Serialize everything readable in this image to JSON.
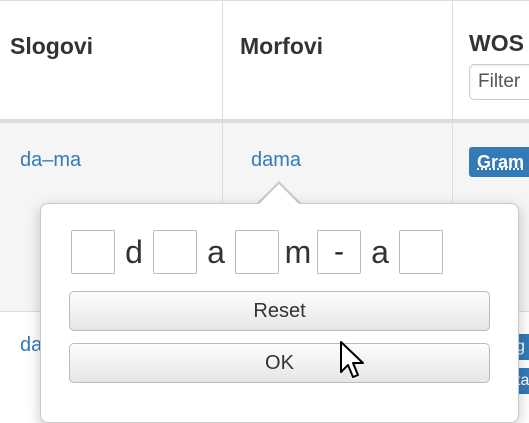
{
  "table": {
    "headers": {
      "slogovi": "Slogovi",
      "morfovi": "Morfovi",
      "wos": "WOS"
    },
    "filter_placeholder": "Filter",
    "row1": {
      "slogovi": "da–ma",
      "morfovi": "dama",
      "badge": "Gram"
    },
    "row2": {
      "slogovi": "da",
      "badge_top": "g",
      "badge_bottom": "ta"
    }
  },
  "popover": {
    "segments": [
      {
        "kind": "box",
        "value": ""
      },
      {
        "kind": "letter",
        "value": "d"
      },
      {
        "kind": "box",
        "value": ""
      },
      {
        "kind": "letter",
        "value": "a"
      },
      {
        "kind": "box",
        "value": ""
      },
      {
        "kind": "letter",
        "value": "m"
      },
      {
        "kind": "box",
        "value": "-"
      },
      {
        "kind": "letter",
        "value": "a"
      },
      {
        "kind": "box",
        "value": ""
      }
    ],
    "reset_label": "Reset",
    "ok_label": "OK"
  },
  "colors": {
    "link": "#337ab7",
    "badge": "#337ab7",
    "border": "#dddddd"
  }
}
